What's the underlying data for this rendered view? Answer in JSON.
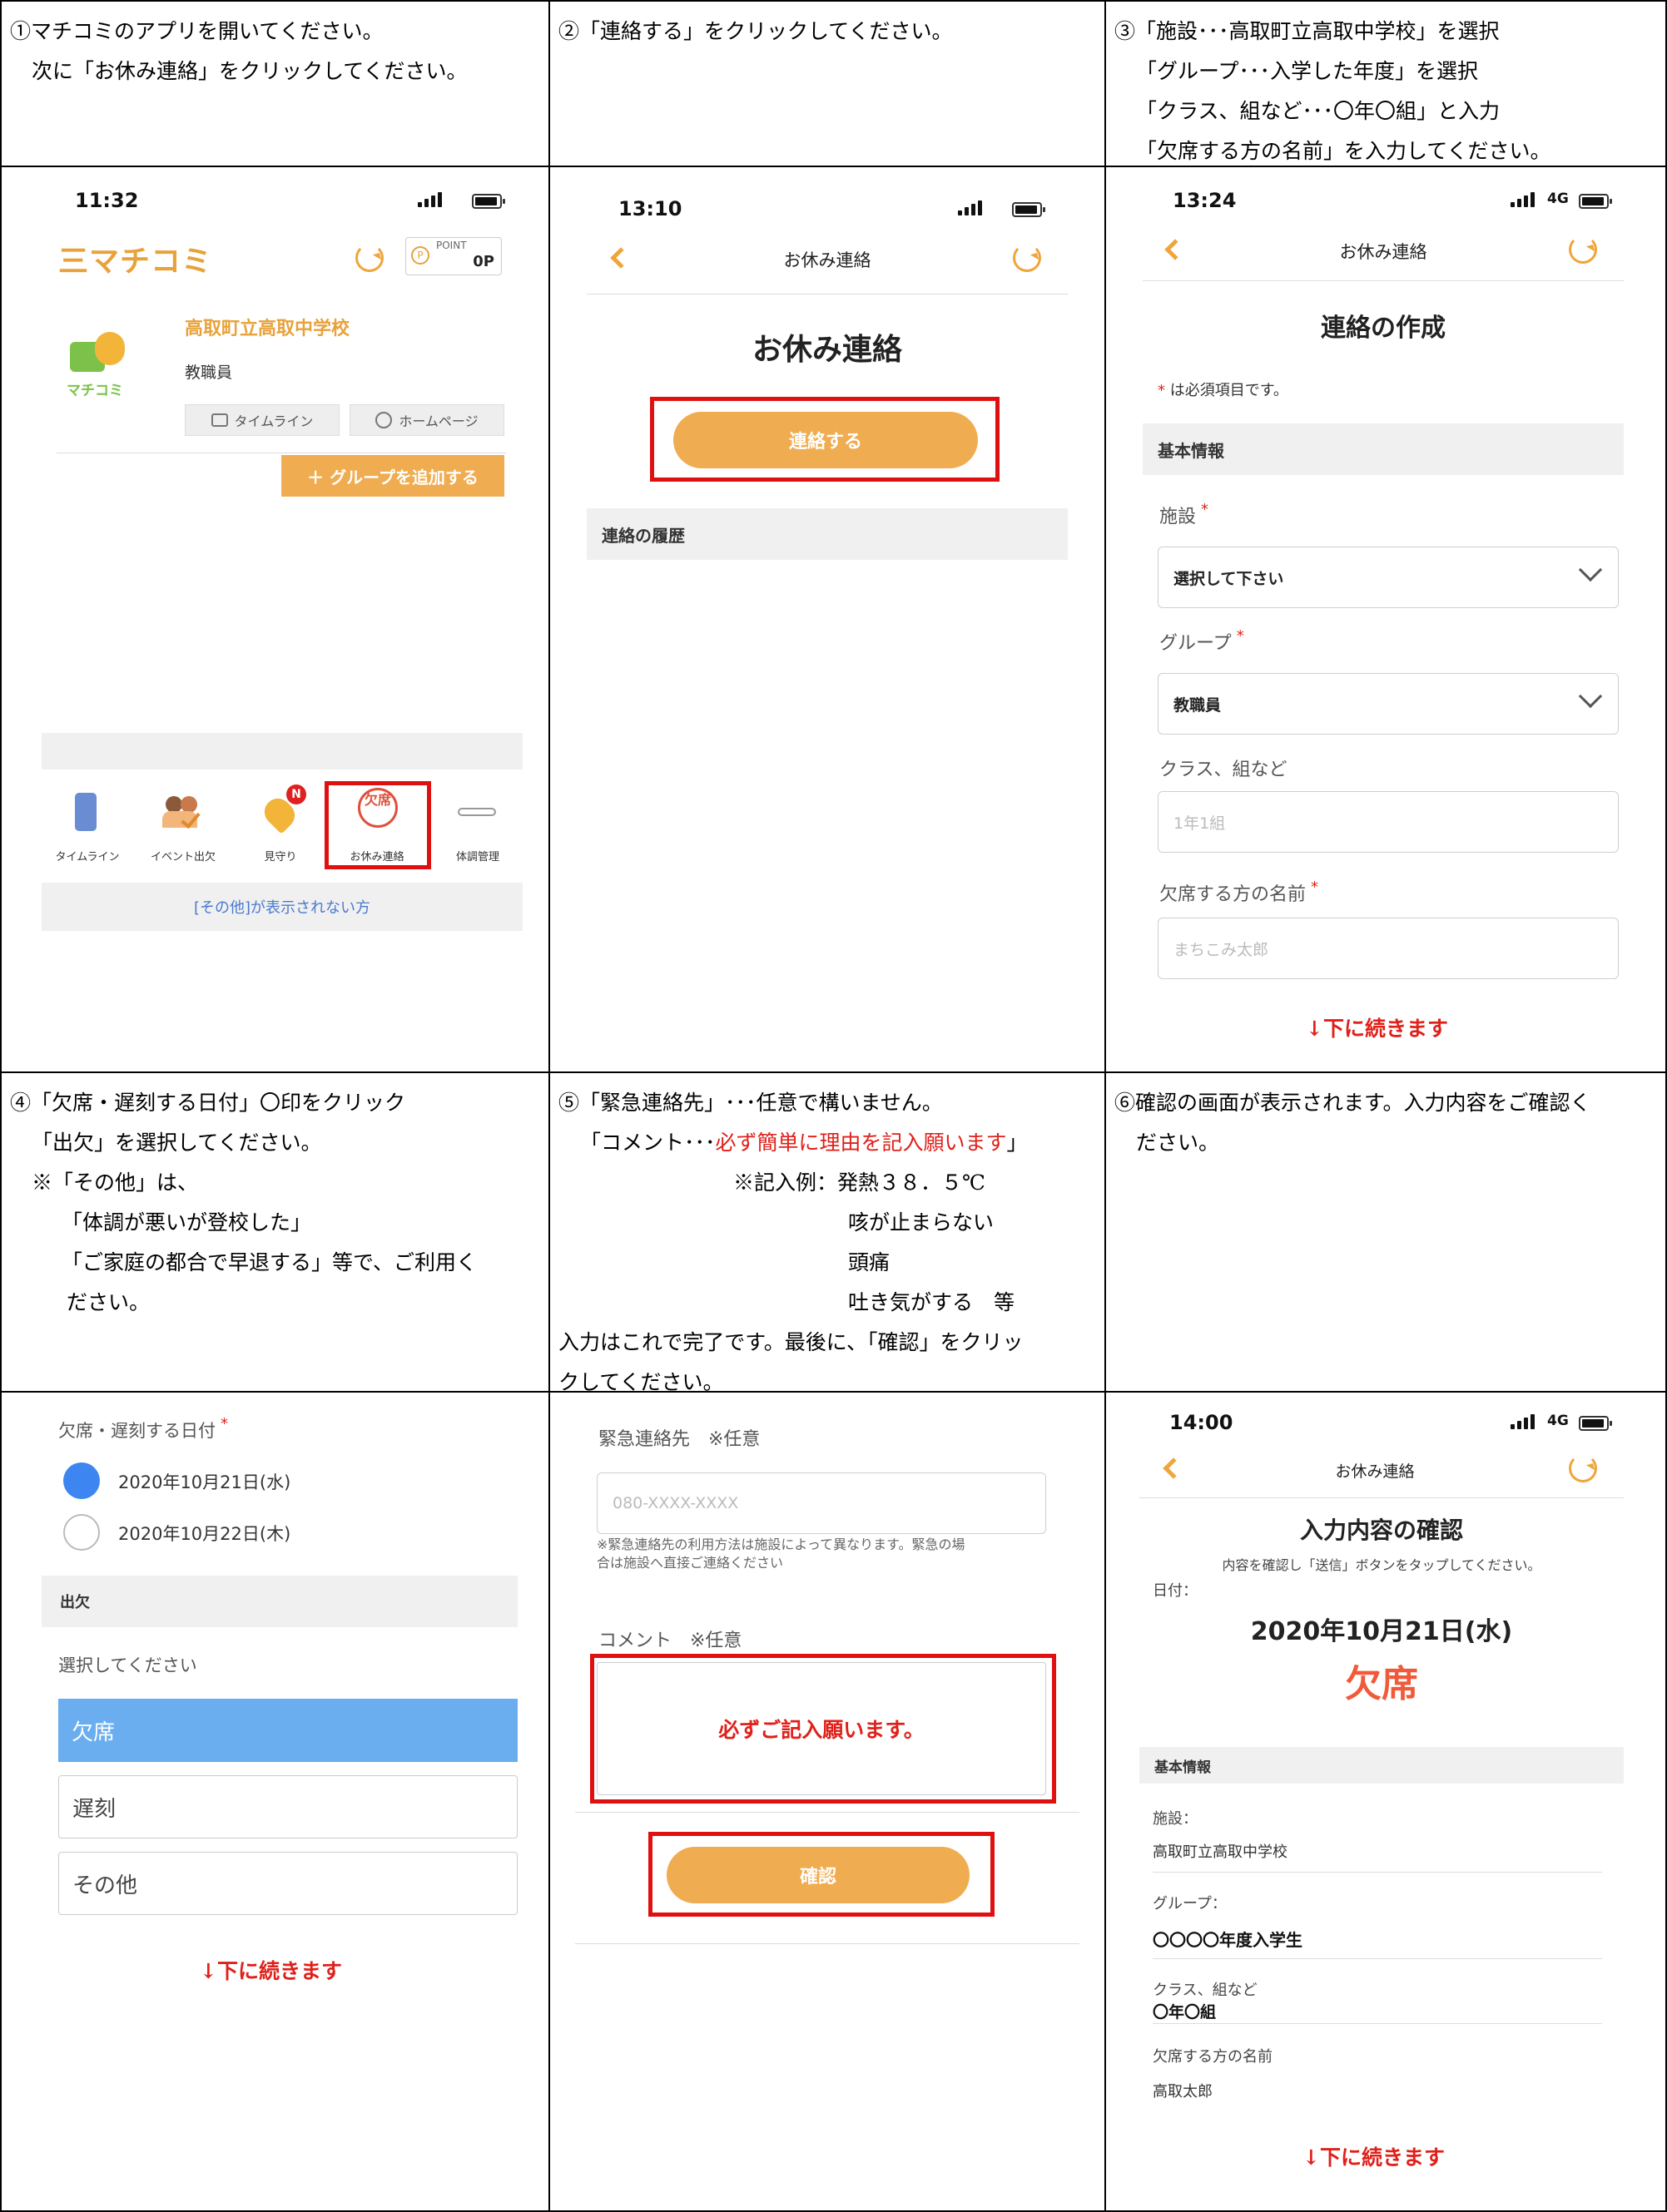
{
  "steps": {
    "s1": [
      "①マチコミのアプリを開いてください。",
      "次に「お休み連絡」をクリックしてください。"
    ],
    "s2": [
      "②「連絡する」をクリックしてください。"
    ],
    "s3": [
      "③「施設･･･高取町立高取中学校」を選択",
      "「グループ･･･入学した年度」を選択",
      "「クラス、組など･･･〇年〇組」と入力",
      "「欠席する方の名前」を入力してください。"
    ],
    "s4": [
      "④「欠席・遅刻する日付」〇印をクリック",
      "「出欠」を選択してください。",
      "※「その他」は、",
      "「体調が悪いが登校した」",
      "「ご家庭の都合で早退する」等で、ご利用く",
      "ださい。"
    ],
    "s5": {
      "l1": "⑤「緊急連絡先」･･･任意で構いません。",
      "l2a": "「コメント･･･",
      "l2b": "必ず簡単に理由を記入願います",
      "l2c": "」",
      "l3": "※記入例：発熱３８．５℃",
      "l4": "咳が止まらない",
      "l5": "頭痛",
      "l6": "吐き気がする　等",
      "l7": "入力はこれで完了です。最後に、「確認」をクリッ",
      "l8": "クしてください。"
    },
    "s6": [
      "⑥確認の画面が表示されます。入力内容をご確認く",
      "ださい。"
    ]
  },
  "screen1": {
    "time": "11:32",
    "logo": "三マチコミ",
    "point_label": "POINT",
    "point_value": "0P",
    "school": "高取町立高取中学校",
    "group": "教職員",
    "app_logo_text": "マチコミ",
    "timeline_btn": "タイムライン",
    "homepage_btn": "ホームページ",
    "add_group_btn": "＋ グループを追加する",
    "tabs": [
      "タイムライン",
      "イベント出欠",
      "見守り",
      "お休み連絡",
      "体調管理"
    ],
    "badge": "N",
    "absence_icon": "欠席",
    "other_link": "[その他]が表示されない方"
  },
  "screen2": {
    "time": "13:10",
    "nav_title": "お休み連絡",
    "page_title": "お休み連絡",
    "contact_btn": "連絡する",
    "history": "連絡の履歴"
  },
  "screen3": {
    "time": "13:24",
    "network": "4G",
    "nav_title": "お休み連絡",
    "page_title": "連絡の作成",
    "required_note_mark": "*",
    "required_note": " は必須項目です。",
    "basic_info": "基本情報",
    "facility_label": "施設",
    "facility_value": "選択して下さい",
    "group_label": "グループ",
    "group_value": "教職員",
    "class_label": "クラス、組など",
    "class_placeholder": "1年1組",
    "name_label": "欠席する方の名前",
    "name_placeholder": "まちこみ太郎",
    "continued": "↓下に続きます"
  },
  "screen4": {
    "date_label": "欠席・遅刻する日付",
    "date1": "2020年10月21日(水)",
    "date2": "2020年10月22日(木)",
    "attendance_header": "出欠",
    "select_prompt": "選択してください",
    "options": [
      "欠席",
      "遅刻",
      "その他"
    ],
    "continued": "↓下に続きます"
  },
  "screen5": {
    "emergency_label": "緊急連絡先　※任意",
    "emergency_placeholder": "080-XXXX-XXXX",
    "emergency_note1": "※緊急連絡先の利用方法は施設によって異なります。緊急の場",
    "emergency_note2": "合は施設へ直接ご連絡ください",
    "comment_label": "コメント　※任意",
    "comment_required": "必ずご記入願います。",
    "confirm_btn": "確認"
  },
  "screen6": {
    "time": "14:00",
    "network": "4G",
    "nav_title": "お休み連絡",
    "page_title": "入力内容の確認",
    "instruction": "内容を確認し「送信」ボタンをタップしてください。",
    "date_label": "日付：",
    "date_value": "2020年10月21日(水)",
    "status": "欠席",
    "basic_info": "基本情報",
    "facility_label": "施設：",
    "facility_value": "高取町立高取中学校",
    "group_label": "グループ：",
    "group_value": "〇〇〇〇年度入学生",
    "class_label": "クラス、組など",
    "class_value": "〇年〇組",
    "name_label": "欠席する方の名前",
    "name_value": "高取太郎",
    "continued": "↓下に続きます"
  },
  "colors": {
    "accent": "#f0ac50",
    "red": "#e0201a",
    "blue": "#3d86f2",
    "select_blue": "#6aaef0"
  }
}
